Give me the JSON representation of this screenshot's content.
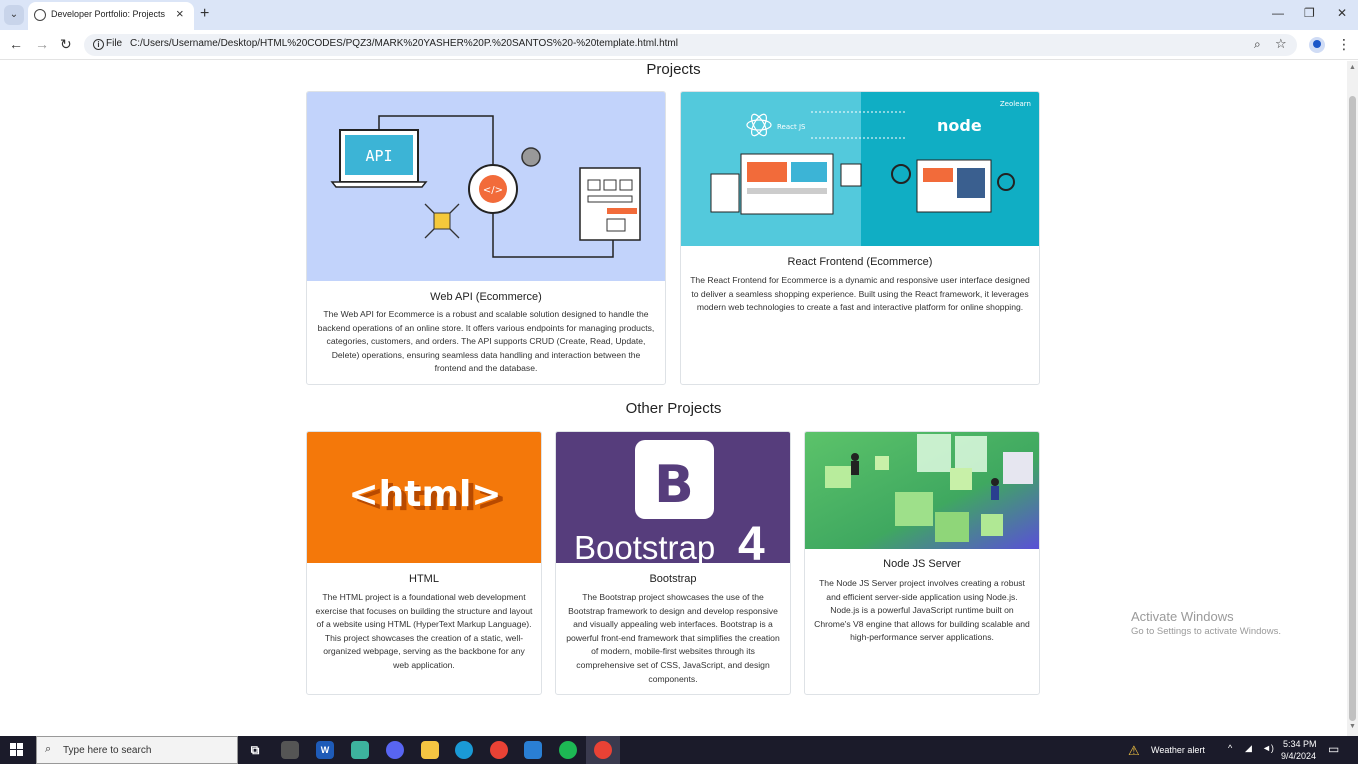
{
  "browser": {
    "tab_title": "Developer Portfolio: Projects",
    "scheme_label": "File",
    "url": "C:/Users/Username/Desktop/HTML%20CODES/PQZ3/MARK%20YASHER%20P.%20SANTOS%20-%20template.html.html"
  },
  "page": {
    "projects_heading": "Projects",
    "other_heading": "Other Projects",
    "projects": [
      {
        "title": "Web API (Ecommerce)",
        "description": "The Web API for Ecommerce is a robust and scalable solution designed to handle the backend operations of an online store. It offers various endpoints for managing products, categories, customers, and orders. The API supports CRUD (Create, Read, Update, Delete) operations, ensuring seamless data handling and interaction between the frontend and the database.",
        "image_label": "API"
      },
      {
        "title": "React Frontend (Ecommerce)",
        "description": "The React Frontend for Ecommerce is a dynamic and responsive user interface designed to deliver a seamless shopping experience. Built using the React framework, it leverages modern web technologies to create a fast and interactive platform for online shopping.",
        "image_label_left": "React JS",
        "image_label_right": "node",
        "image_brand": "Zeolearn"
      }
    ],
    "other_projects": [
      {
        "title": "HTML",
        "description": "The HTML project is a foundational web development exercise that focuses on building the structure and layout of a website using HTML (HyperText Markup Language). This project showcases the creation of a static, well-organized webpage, serving as the backbone for any web application.",
        "image_label": "<html>"
      },
      {
        "title": "Bootstrap",
        "description": "The Bootstrap project showcases the use of the Bootstrap framework to design and develop responsive and visually appealing web interfaces. Bootstrap is a powerful front-end framework that simplifies the creation of modern, mobile-first websites through its comprehensive set of CSS, JavaScript, and design components.",
        "image_label": "Bootstrap",
        "image_logo": "B",
        "image_version": "4"
      },
      {
        "title": "Node JS Server",
        "description": "The Node JS Server project involves creating a robust and efficient server-side application using Node.js. Node.js is a powerful JavaScript runtime built on Chrome's V8 engine that allows for building scalable and high-performance server applications."
      }
    ]
  },
  "watermark": {
    "title": "Activate Windows",
    "subtitle": "Go to Settings to activate Windows."
  },
  "taskbar": {
    "search_placeholder": "Type here to search",
    "weather": "Weather alert",
    "time": "5:34 PM",
    "date": "9/4/2024",
    "app_letters": {
      "word": "W"
    }
  },
  "colors": {
    "api_bg": "#c2d3fb",
    "react_bg_left": "#53c9dc",
    "react_bg_right": "#10aec4",
    "html_bg": "#f4780a",
    "bootstrap_bg": "#563d7c",
    "node_bg": "#4caf50"
  }
}
